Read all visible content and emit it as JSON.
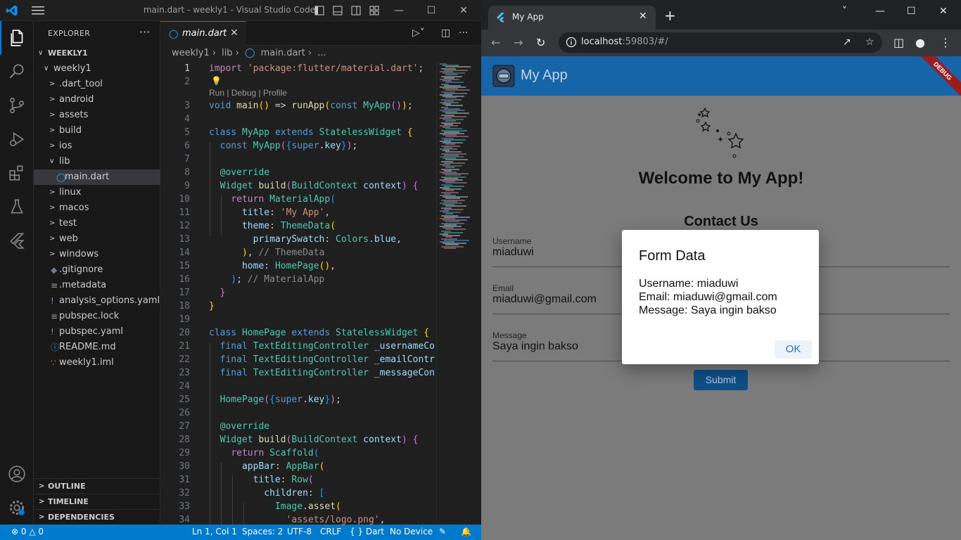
{
  "vscode": {
    "title": "main.dart - weekly1 - Visual Studio Code",
    "explorer": {
      "header": "EXPLORER",
      "root": "WEEKLY1",
      "items": [
        {
          "label": "weekly1",
          "kind": "folder-open",
          "depth": 1
        },
        {
          "label": ".dart_tool",
          "kind": "folder",
          "depth": 2
        },
        {
          "label": "android",
          "kind": "folder",
          "depth": 2
        },
        {
          "label": "assets",
          "kind": "folder",
          "depth": 2
        },
        {
          "label": "build",
          "kind": "folder",
          "depth": 2
        },
        {
          "label": "ios",
          "kind": "folder",
          "depth": 2
        },
        {
          "label": "lib",
          "kind": "folder-open",
          "depth": 2
        },
        {
          "label": "main.dart",
          "kind": "dart-file",
          "depth": 3
        },
        {
          "label": "linux",
          "kind": "folder",
          "depth": 2
        },
        {
          "label": "macos",
          "kind": "folder",
          "depth": 2
        },
        {
          "label": "test",
          "kind": "folder",
          "depth": 2
        },
        {
          "label": "web",
          "kind": "folder",
          "depth": 2
        },
        {
          "label": "windows",
          "kind": "folder",
          "depth": 2
        },
        {
          "label": ".gitignore",
          "kind": "git-file",
          "depth": 2
        },
        {
          "label": ".metadata",
          "kind": "text-file",
          "depth": 2
        },
        {
          "label": "analysis_options.yaml",
          "kind": "yaml-file",
          "depth": 2
        },
        {
          "label": "pubspec.lock",
          "kind": "text-file",
          "depth": 2
        },
        {
          "label": "pubspec.yaml",
          "kind": "yaml-file",
          "depth": 2
        },
        {
          "label": "README.md",
          "kind": "info-file",
          "depth": 2
        },
        {
          "label": "weekly1.iml",
          "kind": "rss-file",
          "depth": 2
        }
      ],
      "sections": [
        "OUTLINE",
        "TIMELINE",
        "DEPENDENCIES"
      ]
    },
    "tab": {
      "label": "main.dart"
    },
    "breadcrumb": [
      "weekly1",
      "lib",
      "main.dart",
      "..."
    ],
    "codelens": "Run | Debug | Profile",
    "line_numbers": [
      "1",
      "2",
      "3",
      "4",
      "5",
      "6",
      "7",
      "8",
      "9",
      "10",
      "11",
      "12",
      "13",
      "14",
      "15",
      "16",
      "17",
      "18",
      "19",
      "20",
      "21",
      "22",
      "23",
      "24",
      "25",
      "26",
      "27",
      "28",
      "29",
      "30",
      "31",
      "32",
      "33",
      "34"
    ],
    "status": {
      "errors": "0",
      "warnings": "0",
      "position": "Ln 1, Col 1",
      "spaces": "Spaces: 2",
      "encoding": "UTF-8",
      "eol": "CRLF",
      "language": "Dart",
      "device": "No Device"
    }
  },
  "browser": {
    "tab_title": "My App",
    "url_host": "localhost",
    "url_rest": ":59803/#/"
  },
  "app": {
    "title": "My App",
    "debug_banner": "DEBUG",
    "welcome": "Welcome to My App!",
    "contact": "Contact Us",
    "fields": [
      {
        "label": "Username",
        "value": "miaduwi"
      },
      {
        "label": "Email",
        "value": "miaduwi@gmail.com"
      },
      {
        "label": "Message",
        "value": "Saya ingin bakso"
      }
    ],
    "submit": "Submit",
    "dialog": {
      "title": "Form Data",
      "lines": [
        "Username: miaduwi",
        "Email: miaduwi@gmail.com",
        "Message: Saya ingin bakso"
      ],
      "ok": "OK"
    }
  },
  "colors": {
    "vscode_accent": "#0078d4",
    "statusbar": "#007acc",
    "appbar": "#1565a8",
    "debug_banner": "#9b1c1c"
  }
}
